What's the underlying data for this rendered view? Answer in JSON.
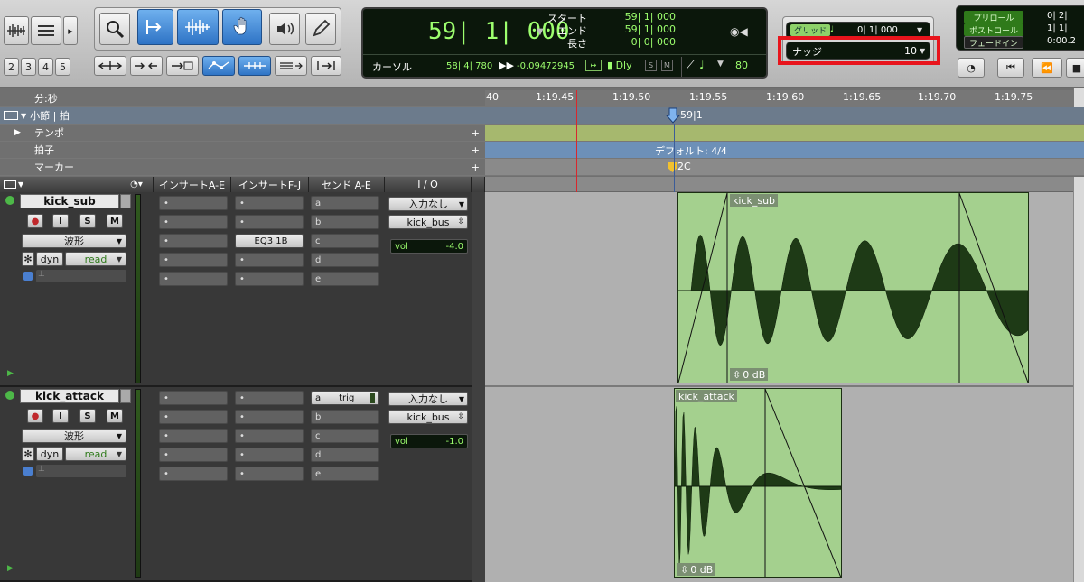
{
  "toolbar": {
    "zoom_presets": [
      "2",
      "3",
      "4",
      "5"
    ],
    "counter_main": "59| 1| 000",
    "start_label": "スタート",
    "end_label": "エンド",
    "length_label": "長さ",
    "start_value": "59| 1| 000",
    "end_value": "59| 1| 000",
    "length_value": "0| 0| 000",
    "cursor_label": "カーソル",
    "cursor_value": "58| 4| 780",
    "sample_value": "-0.09472945",
    "dly_label": "Dly",
    "s_label": "S",
    "m_label": "M",
    "nudge_amount": "80",
    "grid_label": "グリッド",
    "grid_value": "0| 1| 000",
    "nudge_label": "ナッジ",
    "nudge_value": "10",
    "preroll_label": "プリロール",
    "postroll_label": "ポストロール",
    "fadein_label": "フェードイン",
    "preroll_value": "0| 2|",
    "postroll_value": "1| 1|",
    "fadein_value": "0:00.2",
    "highlight_color": "#e8141c"
  },
  "rulers": {
    "minsec": "分:秒",
    "bars": "小節 | 拍",
    "tempo": "テンポ",
    "meter": "拍子",
    "marker": "マーカー",
    "ticks": [
      "40",
      "1:19.45",
      "1:19.50",
      "1:19.55",
      "1:19.60",
      "1:19.65",
      "1:19.70",
      "1:19.75"
    ],
    "bar_marker": "59|1",
    "meter_value": "デフォルト: 4/4",
    "marker_name": "2C"
  },
  "columns": {
    "insert_ae": "インサートA-E",
    "insert_fj": "インサートF-J",
    "send_ae": "センド A-E",
    "io": "I / O"
  },
  "tracks": [
    {
      "name": "kick_sub",
      "view": "波形",
      "dyn": "dyn",
      "mode": "read",
      "inserts_ae": [
        "•",
        "•",
        "•",
        "•",
        "•"
      ],
      "inserts_fj": [
        "•",
        "•",
        "EQ3 1B",
        "•",
        "•"
      ],
      "sends": [
        "a",
        "b",
        "c",
        "d",
        "e"
      ],
      "input": "入力なし",
      "output": "kick_bus",
      "vol_label": "vol",
      "vol_value": "-4.0",
      "region_name": "kick_sub",
      "region_gain": "0 dB"
    },
    {
      "name": "kick_attack",
      "view": "波形",
      "dyn": "dyn",
      "mode": "read",
      "inserts_ae": [
        "•",
        "•",
        "•",
        "•",
        "•"
      ],
      "inserts_fj": [
        "•",
        "•",
        "•",
        "•",
        "•"
      ],
      "sends": [
        "a",
        "b",
        "c",
        "d",
        "e"
      ],
      "send_a_name": "trig",
      "input": "入力なし",
      "output": "kick_bus",
      "vol_label": "vol",
      "vol_value": "-1.0",
      "region_name": "kick_attack",
      "region_gain": "0 dB"
    }
  ],
  "btn": {
    "rec": "●",
    "input": "I",
    "solo": "S",
    "mute": "M"
  }
}
